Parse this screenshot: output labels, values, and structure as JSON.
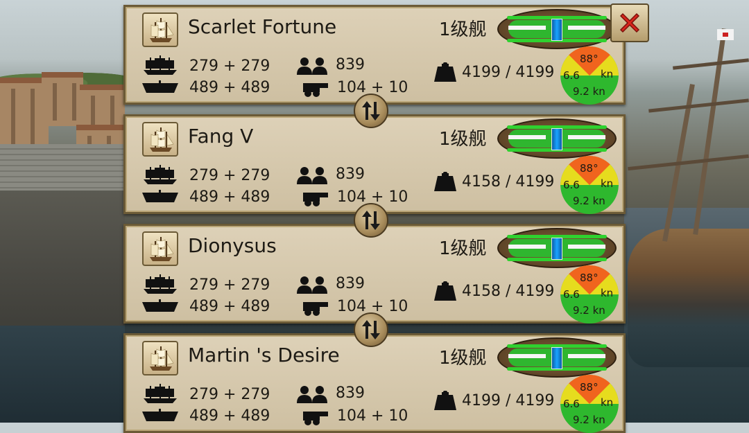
{
  "ships": [
    {
      "name": "Scarlet Fortune",
      "class": "1级舰",
      "cannons_side": "279 + 279",
      "hull": "489 + 489",
      "crew": "839",
      "guns": "104 + 10",
      "cargo": "4199 / 4199",
      "speed": {
        "angle": "88°",
        "left": "6.6",
        "unit": "kn",
        "bottom": "9.2 kn"
      }
    },
    {
      "name": "Fang V",
      "class": "1级舰",
      "cannons_side": "279 + 279",
      "hull": "489 + 489",
      "crew": "839",
      "guns": "104 + 10",
      "cargo": "4158 / 4199",
      "speed": {
        "angle": "88°",
        "left": "6.6",
        "unit": "kn",
        "bottom": "9.2 kn"
      }
    },
    {
      "name": "Dionysus",
      "class": "1级舰",
      "cannons_side": "279 + 279",
      "hull": "489 + 489",
      "crew": "839",
      "guns": "104 + 10",
      "cargo": "4158 / 4199",
      "speed": {
        "angle": "88°",
        "left": "6.6",
        "unit": "kn",
        "bottom": "9.2 kn"
      }
    },
    {
      "name": "Martin 's Desire",
      "class": "1级舰",
      "cannons_side": "279 + 279",
      "hull": "489 + 489",
      "crew": "839",
      "guns": "104 + 10",
      "cargo": "4199 / 4199",
      "speed": {
        "angle": "88°",
        "left": "6.6",
        "unit": "kn",
        "bottom": "9.2 kn"
      }
    }
  ],
  "colors": {
    "panel": "#d6c7a8",
    "panel_border": "#6b5a36",
    "slider_green": "#2fd12f",
    "slider_knob": "#19a3ff",
    "speed_red": "#f0641e",
    "speed_yellow": "#e6dc1e",
    "speed_green": "#2eb82e",
    "close_red": "#d8261c"
  },
  "icons": {
    "close": "close-icon",
    "swap": "swap-arrows-icon",
    "cannons": "ship-broadside-icon",
    "hull": "ship-hull-icon",
    "crew": "crew-icon",
    "guns": "cannon-icon",
    "cargo": "weight-icon"
  }
}
